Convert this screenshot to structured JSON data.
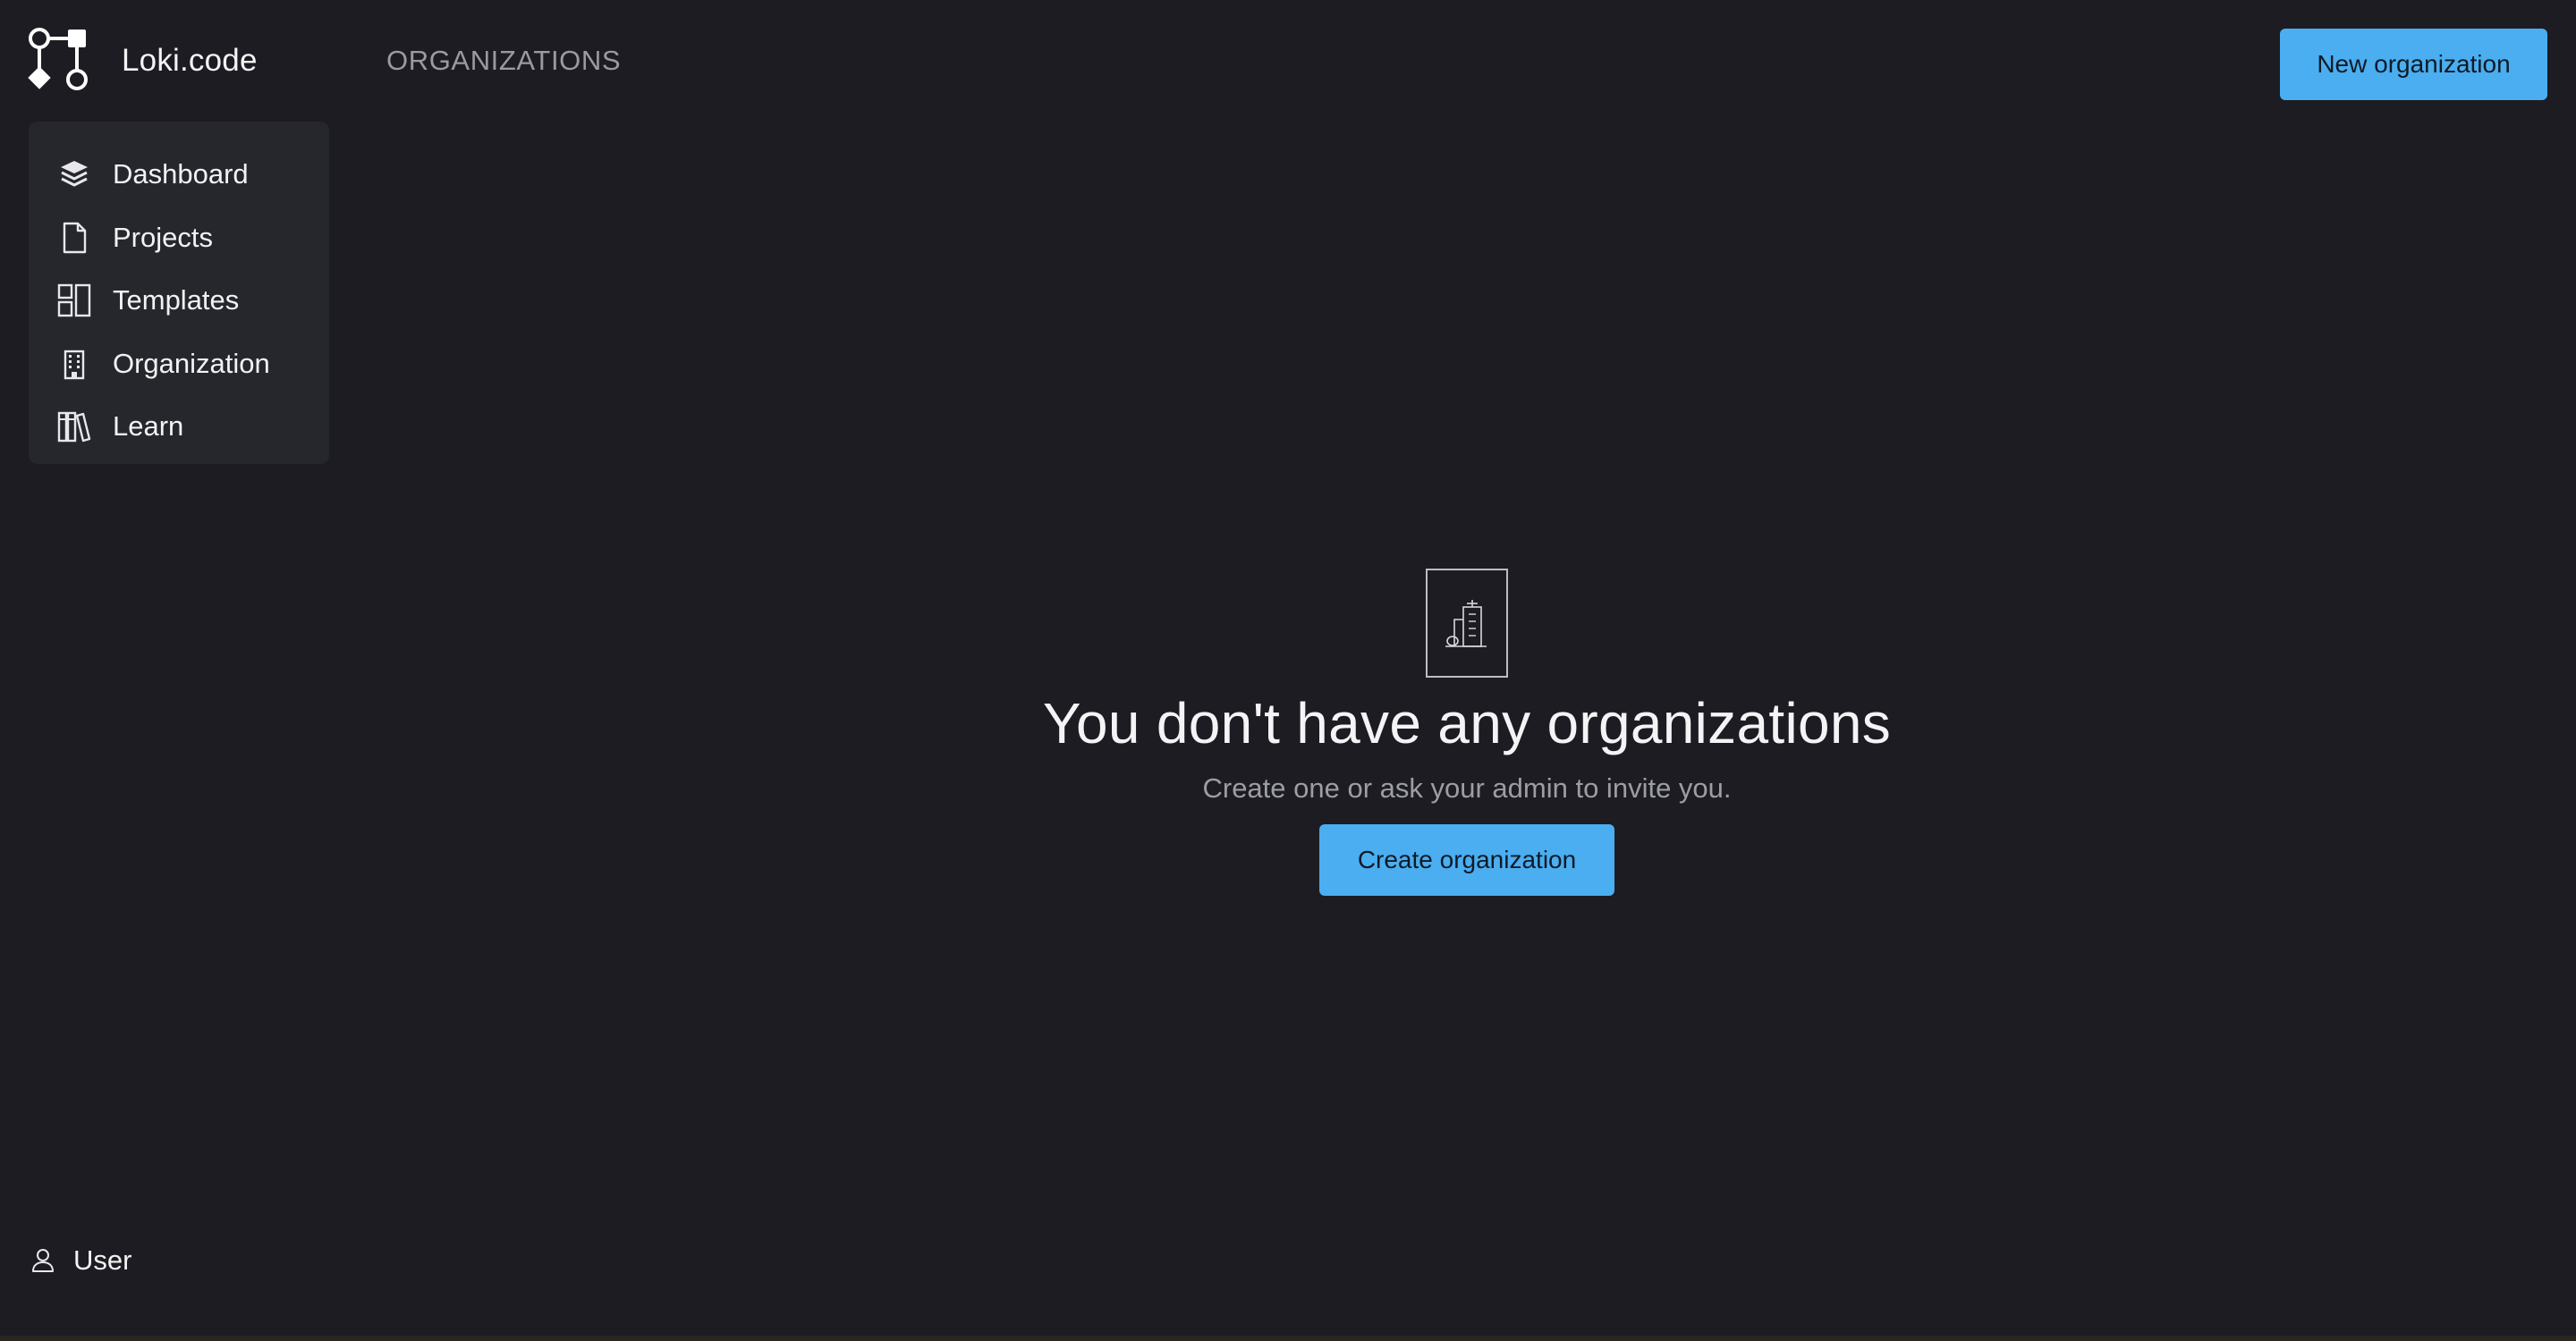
{
  "app": {
    "name": "Loki.code"
  },
  "header": {
    "title": "ORGANIZATIONS",
    "new_button_label": "New organization"
  },
  "sidebar": {
    "items": [
      {
        "label": "Dashboard",
        "icon": "layers-icon"
      },
      {
        "label": "Projects",
        "icon": "file-icon"
      },
      {
        "label": "Templates",
        "icon": "layout-icon"
      },
      {
        "label": "Organization",
        "icon": "building-icon"
      },
      {
        "label": "Learn",
        "icon": "books-icon"
      }
    ]
  },
  "empty_state": {
    "icon": "building-illustration-icon",
    "title": "You don't have any organizations",
    "subtitle": "Create one or ask your admin to invite you.",
    "button_label": "Create organization"
  },
  "user": {
    "label": "User",
    "icon": "user-icon"
  },
  "colors": {
    "background": "#1c1c22",
    "sidebar": "#26272d",
    "accent": "#4aaef0",
    "muted_text": "#9a9aa2"
  }
}
